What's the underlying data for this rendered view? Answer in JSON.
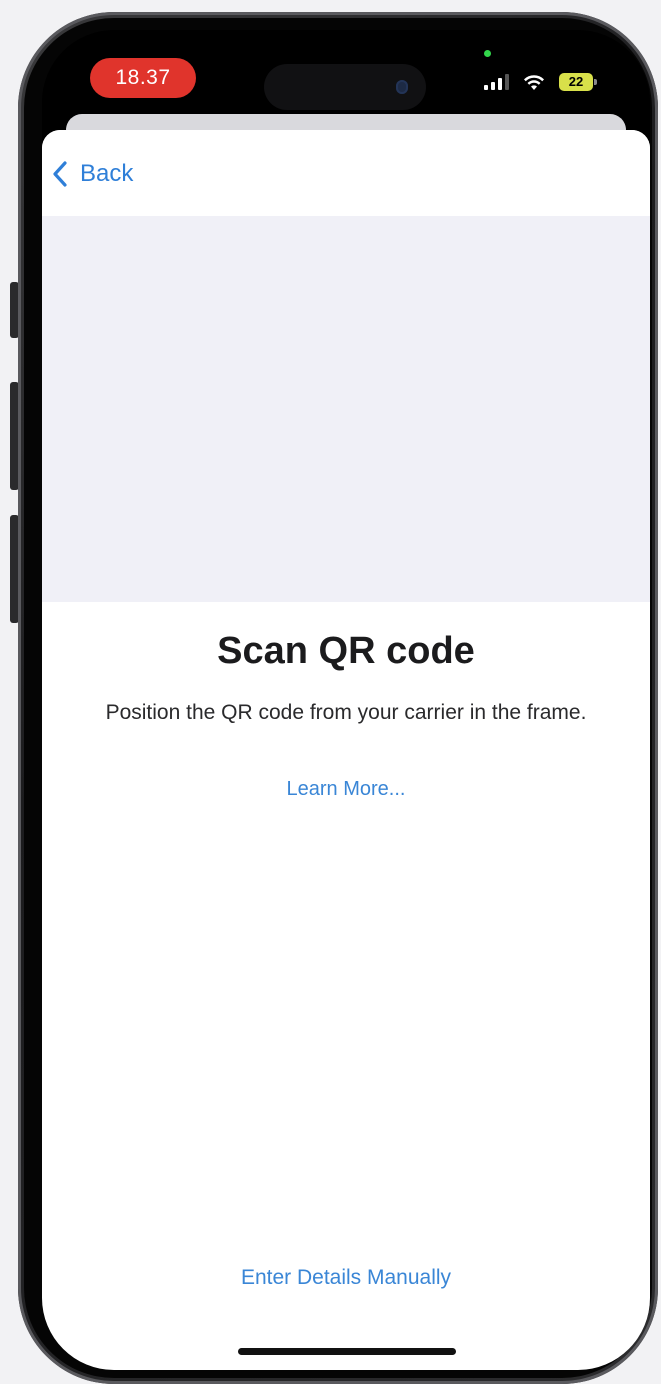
{
  "status_bar": {
    "time": "18.37",
    "battery": "22",
    "icons": [
      "signal-icon",
      "wifi-icon",
      "battery-icon"
    ],
    "time_pill_color": "#e0342c",
    "mic_indicator_color": "#32d74b"
  },
  "nav": {
    "back_label": "Back",
    "back_icon": "chevron-left-icon"
  },
  "content": {
    "title": "Scan QR code",
    "subtitle": "Position the QR code from your carrier in the frame.",
    "learn_more": "Learn More..."
  },
  "footer": {
    "manual_entry": "Enter Details Manually"
  },
  "colors": {
    "accent": "#3a86d6",
    "camera_background": "#f0f0f7"
  }
}
